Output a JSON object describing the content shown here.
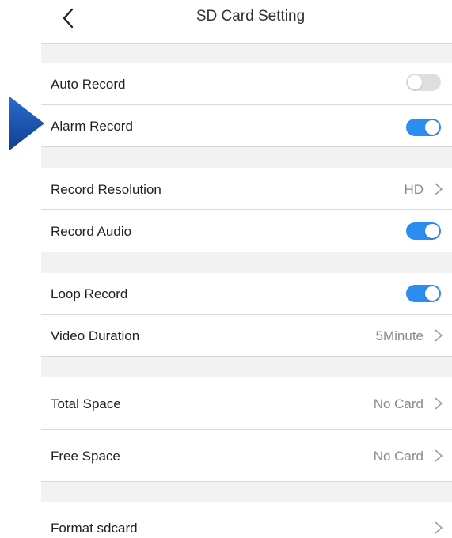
{
  "header": {
    "title": "SD Card Setting"
  },
  "colors": {
    "accent": "#2d8cf0",
    "toggle_off": "#dedede",
    "pointer": "#1a4fa3",
    "gap": "#f2f2f2"
  },
  "rows": {
    "auto_record": {
      "label": "Auto Record",
      "toggle": "off"
    },
    "alarm_record": {
      "label": "Alarm Record",
      "toggle": "on"
    },
    "record_resolution": {
      "label": "Record Resolution",
      "value": "HD"
    },
    "record_audio": {
      "label": "Record Audio",
      "toggle": "on"
    },
    "loop_record": {
      "label": "Loop Record",
      "toggle": "on"
    },
    "video_duration": {
      "label": "Video Duration",
      "value": "5Minute"
    },
    "total_space": {
      "label": "Total Space",
      "value": "No Card"
    },
    "free_space": {
      "label": "Free Space",
      "value": "No Card"
    },
    "format_sdcard": {
      "label": "Format sdcard"
    }
  },
  "icons": {
    "back": "chevron-left-icon",
    "row_arrow": "chevron-right-icon",
    "annotation": "triangle-pointer-icon"
  }
}
